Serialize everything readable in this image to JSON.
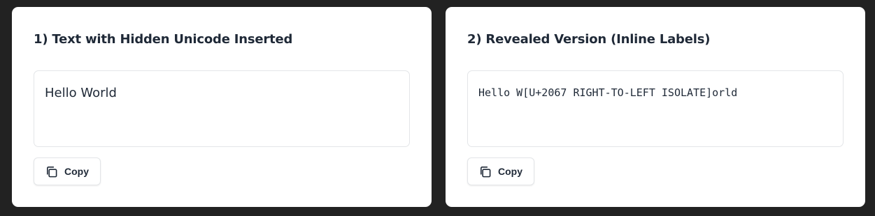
{
  "cards": [
    {
      "title": "1) Text with Hidden Unicode Inserted",
      "content": "Hello W⁧orld",
      "copy_label": "Copy"
    },
    {
      "title": "2) Revealed Version (Inline Labels)",
      "content": "Hello W[U+2067 RIGHT-TO-LEFT ISOLATE]orld",
      "copy_label": "Copy"
    }
  ],
  "icons": {
    "copy": "copy-icon"
  }
}
